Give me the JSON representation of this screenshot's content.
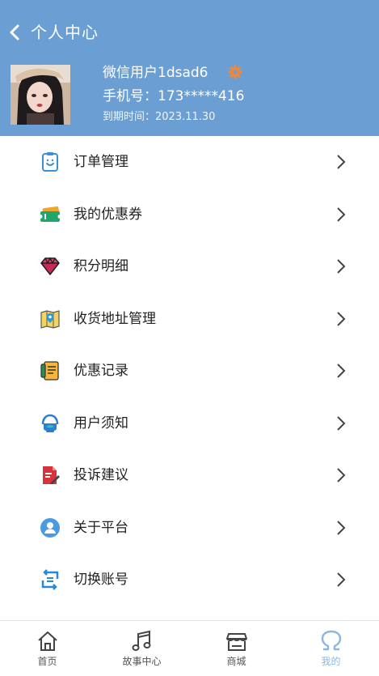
{
  "header": {
    "title": "个人中心",
    "username": "微信用户1dsad6",
    "phone": "手机号：173*****416",
    "expiry": "到期时间：2023.11.30",
    "background_color": "#6b9fd3"
  },
  "menu": [
    {
      "label": "订单管理",
      "icon": "clipboard-icon"
    },
    {
      "label": "我的优惠券",
      "icon": "coupon-icon"
    },
    {
      "label": "积分明细",
      "icon": "diamond-icon"
    },
    {
      "label": "收货地址管理",
      "icon": "map-icon"
    },
    {
      "label": "优惠记录",
      "icon": "notebook-icon"
    },
    {
      "label": "用户须知",
      "icon": "headset-icon"
    },
    {
      "label": "投诉建议",
      "icon": "complaint-doc-icon"
    },
    {
      "label": "关于平台",
      "icon": "user-circle-icon"
    },
    {
      "label": "切换账号",
      "icon": "switch-icon"
    }
  ],
  "tabbar": [
    {
      "label": "首页",
      "icon": "home-icon"
    },
    {
      "label": "故事中心",
      "icon": "music-note-icon"
    },
    {
      "label": "商城",
      "icon": "store-icon"
    },
    {
      "label": "我的",
      "icon": "omega-icon",
      "active": true
    }
  ],
  "colors": {
    "tab_active": "#8db7df",
    "gear": "#f0883a"
  }
}
